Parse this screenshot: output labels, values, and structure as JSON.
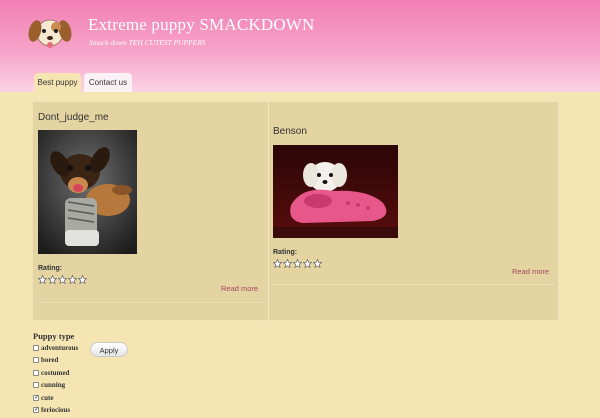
{
  "header": {
    "site_name": "Extreme puppy SMACKDOWN",
    "slogan": "Smack down TEH CUTEST PUPPERS",
    "logo_icon": "puppy-face-icon"
  },
  "tabs": [
    {
      "label": "Best puppy",
      "active": true
    },
    {
      "label": "Contact us",
      "active": false
    }
  ],
  "puppies": [
    {
      "name": "Dont_judge_me",
      "rating_label": "Rating:",
      "stars_filled": 0,
      "stars_total": 5,
      "read_more": "Read more"
    },
    {
      "name": "Benson",
      "rating_label": "Rating:",
      "stars_filled": 0,
      "stars_total": 5,
      "read_more": "Read more"
    }
  ],
  "filter": {
    "title": "Puppy type",
    "apply_label": "Apply",
    "options": [
      {
        "label": "adventurous",
        "checked": false
      },
      {
        "label": "bored",
        "checked": false
      },
      {
        "label": "costumed",
        "checked": false
      },
      {
        "label": "cunning",
        "checked": false
      },
      {
        "label": "cute",
        "checked": true
      },
      {
        "label": "feriocious",
        "checked": true
      }
    ]
  },
  "colors": {
    "header_pink": "#f17fb3",
    "background": "#f5e5b3",
    "panel": "#e4d4a2",
    "link": "#a3475a"
  }
}
